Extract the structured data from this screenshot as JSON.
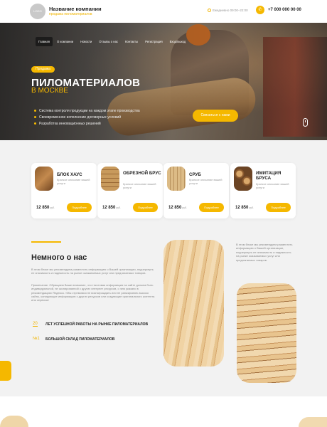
{
  "header": {
    "logo_text": "LOGO",
    "company_name": "Название компании",
    "company_sub": "продажа пиломатериалов",
    "schedule": "Ежедневно 09:00–22:00",
    "phone": "+7 000 000 00 00"
  },
  "nav": [
    "Главная",
    "О компании",
    "Новости",
    "Отзывы о нас",
    "Контакты",
    "Регистрация",
    "Вход/выход"
  ],
  "hero": {
    "badge": "Продажа",
    "title": "ПИЛОМАТЕРИАЛОВ",
    "subtitle": "В МОСКВЕ",
    "bullets": [
      "Система контроля продукции на каждом этапе производства",
      "Своевременное исполнение договорных условий",
      "Разработка инновационных решений"
    ],
    "cta": "Связаться с нами"
  },
  "products": [
    {
      "name": "БЛОК ХАУС",
      "desc": "Краткое описание вашей услуги",
      "price": "12 850",
      "unit": "руб.",
      "button": "Подробнее"
    },
    {
      "name": "ОБРЕЗНОЙ БРУС",
      "desc": "Краткое описание вашей услуги",
      "price": "12 850",
      "unit": "руб.",
      "button": "Подробнее"
    },
    {
      "name": "СРУБ",
      "desc": "Краткое описание вашей услуги",
      "price": "12 850",
      "unit": "руб.",
      "button": "Подробнее"
    },
    {
      "name": "ИМИТАЦИЯ БРУСА",
      "desc": "Краткое описание вашей услуги",
      "price": "12 850",
      "unit": "руб.",
      "button": "Подробнее"
    }
  ],
  "about": {
    "title": "Немного о нас",
    "p1": "В этом блоке мы рекомендуем разместить информацию о Вашей организации, подчеркнуть ее значимость и надежность на рынке оказываемых услуг или предлагаемых товаров.",
    "p2": "Примечание. Обращаем Ваше внимание, что текстовая информация на сайте должна быть индивидуальной, не скопированной с других интернет ресурсов, о чем указано в рекомендациях Яндекса. «Мы стремимся не вознаграждать или не ранжировать высоко сайты, копирующие информацию с других ресурсов или создающие оригинального контента или сервиса»",
    "right_text": "В этом блоке мы рекомендуем разместить информацию о Вашей организации, подчеркнуть ее значимость и надежность на рынке оказываемых услуг или предлагаемых товаров.",
    "stats": [
      {
        "num": "20",
        "label": "ЛЕТ УСПЕШНОЙ РАБОТЫ НА РЫНКЕ ПИЛОМАТЕРИАЛОВ"
      },
      {
        "num": "№1",
        "label": "БОЛЬШОЙ СКЛАД ПИЛОМАТЕРИАЛОВ"
      }
    ]
  },
  "colors": {
    "accent": "#f5b800",
    "section_bg": "#f2f2f2"
  }
}
